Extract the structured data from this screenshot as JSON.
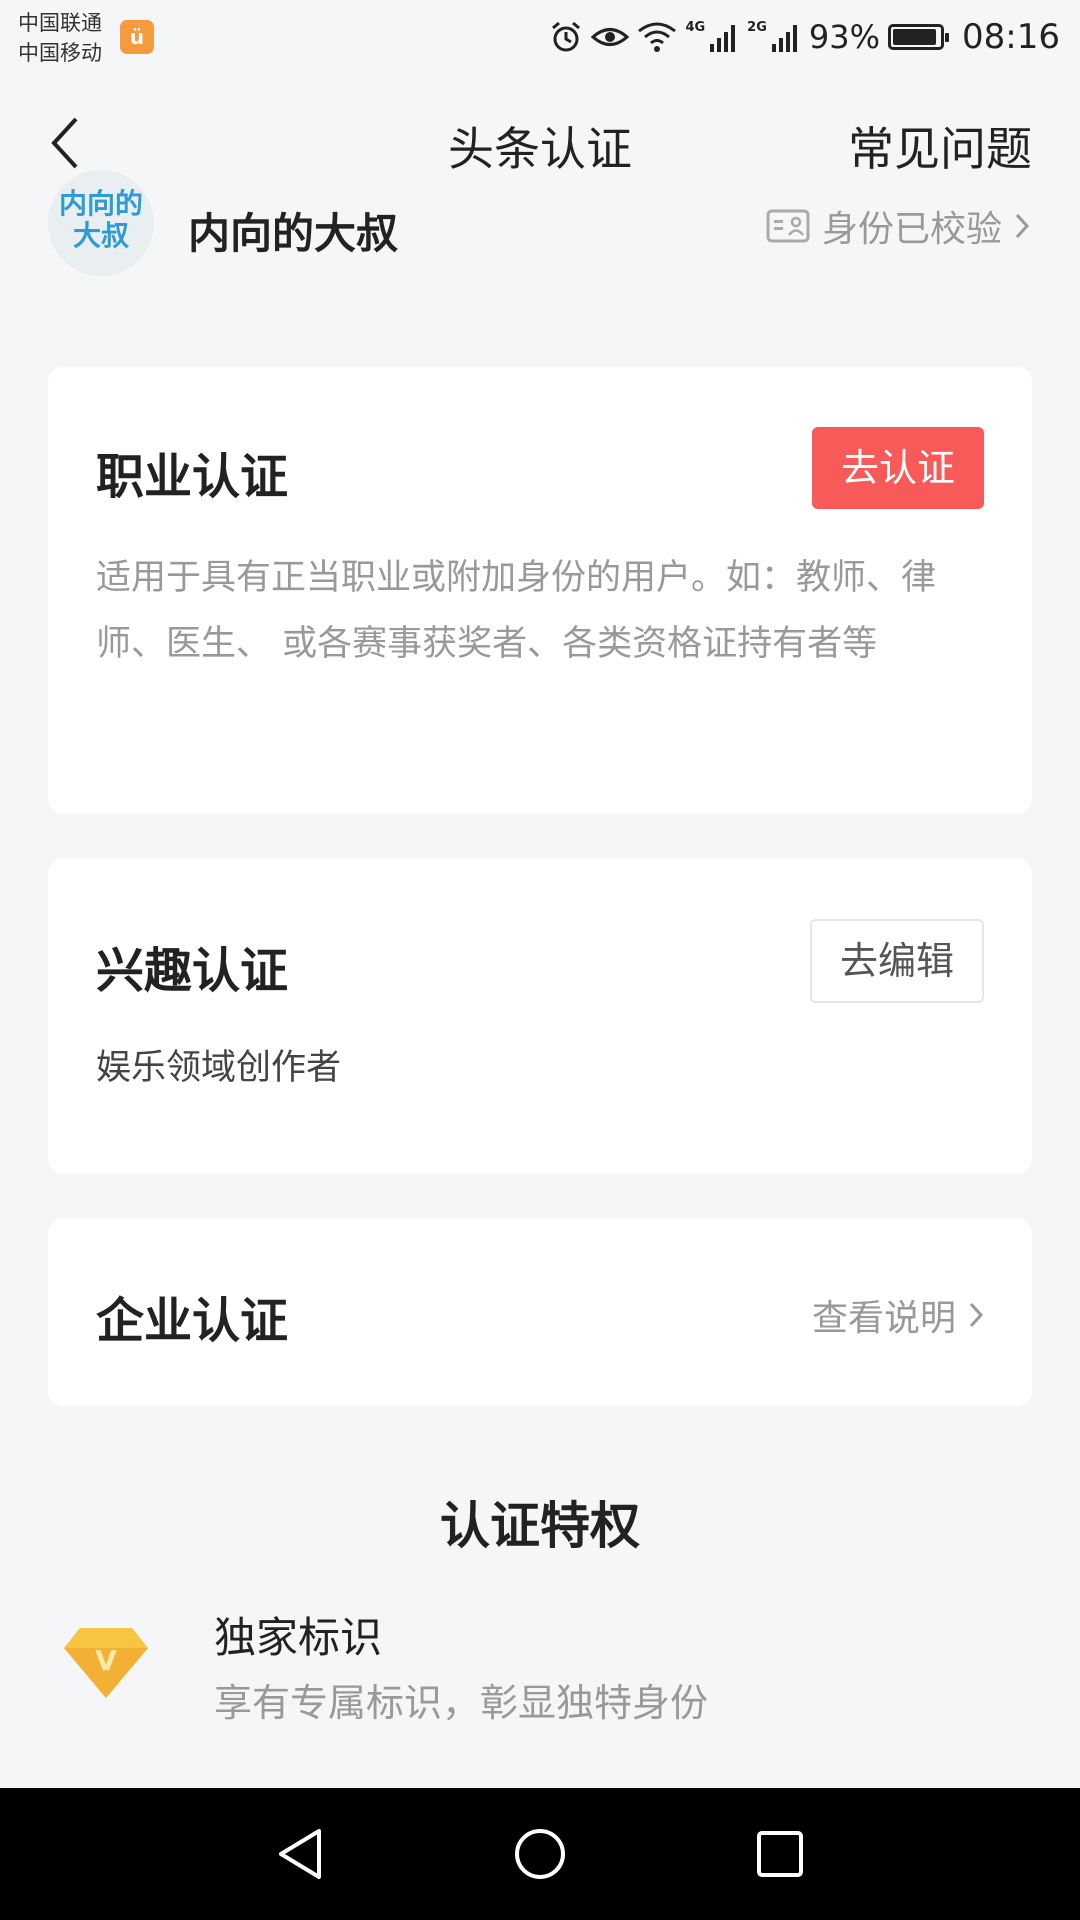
{
  "status_bar": {
    "carrier_1": "中国联通",
    "carrier_2": "中国移动",
    "net_1": "4G",
    "net_2": "2G",
    "battery_percent": "93%",
    "battery_level": 0.93,
    "time": "08:16",
    "icons": [
      "alarm-icon",
      "eye-icon",
      "wifi-icon",
      "signal-icon",
      "battery-icon"
    ]
  },
  "nav": {
    "title": "头条认证",
    "faq": "常见问题"
  },
  "user": {
    "avatar_text": "内向的大叔",
    "name": "内向的大叔",
    "verify_status": "身份已校验"
  },
  "cards": {
    "professional": {
      "title": "职业认证",
      "button": "去认证",
      "description": "适用于具有正当职业或附加身份的用户。如：教师、律师、医生、 或各赛事获奖者、各类资格证持有者等"
    },
    "interest": {
      "title": "兴趣认证",
      "button": "去编辑",
      "description": "娱乐领域创作者"
    },
    "enterprise": {
      "title": "企业认证",
      "link": "查看说明"
    }
  },
  "privileges": {
    "heading": "认证特权",
    "items": [
      {
        "icon": "v-diamond-icon",
        "icon_letter": "V",
        "title": "独家标识",
        "description": "享有专属标识，彰显独特身份"
      }
    ]
  },
  "colors": {
    "accent": "#f85959",
    "background": "#f5f6f7",
    "muted_text": "#999999",
    "badge_gold": "#f7c541"
  }
}
